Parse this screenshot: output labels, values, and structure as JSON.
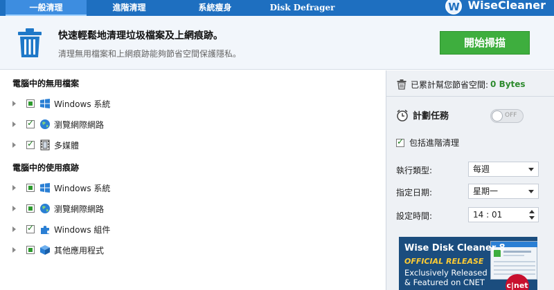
{
  "tabs": [
    "一般清理",
    "進階清理",
    "系統瘦身",
    "Disk Defrager"
  ],
  "brand": {
    "logo_letter": "W",
    "name": "WiseCleaner"
  },
  "header": {
    "title": "快速輕鬆地清理垃圾檔案及上網痕跡。",
    "subtitle": "清理無用檔案和上網痕跡能夠節省空間保護隱私。",
    "scan_button": "開始掃描"
  },
  "sections": [
    {
      "title": "電腦中的無用檔案",
      "items": [
        {
          "label": "Windows 系統",
          "icon": "windows-icon",
          "state": "partial"
        },
        {
          "label": "瀏覽網際網路",
          "icon": "globe-icon",
          "state": "checked"
        },
        {
          "label": "多媒體",
          "icon": "film-icon",
          "state": "checked"
        }
      ]
    },
    {
      "title": "電腦中的使用痕跡",
      "items": [
        {
          "label": "Windows 系統",
          "icon": "windows-icon",
          "state": "partial"
        },
        {
          "label": "瀏覽網際網路",
          "icon": "globe-icon",
          "state": "partial"
        },
        {
          "label": "Windows 組件",
          "icon": "puzzle-icon",
          "state": "checked"
        },
        {
          "label": "其他應用程式",
          "icon": "box-icon",
          "state": "partial"
        }
      ]
    }
  ],
  "right": {
    "saved_label": "已累計幫您節省空間:",
    "saved_value": "0 Bytes",
    "schedule_label": "計劃任務",
    "toggle_text": "OFF",
    "include_advanced": "包括進階清理",
    "run_type_label": "執行類型:",
    "run_type_value": "每週",
    "date_label": "指定日期:",
    "date_value": "星期一",
    "time_label": "設定時間:",
    "time_value": "14 : 01"
  },
  "ad": {
    "title": "Wise Disk Cleaner 8",
    "tag": "OFFICIAL RELEASE",
    "line1": "Exclusively Released",
    "line2": "& Featured on CNET",
    "badge": "c|net"
  },
  "colors": {
    "topbar": "#1e6fc0",
    "scan_button": "#3eae3e",
    "saved_value": "#2e8b2e"
  }
}
